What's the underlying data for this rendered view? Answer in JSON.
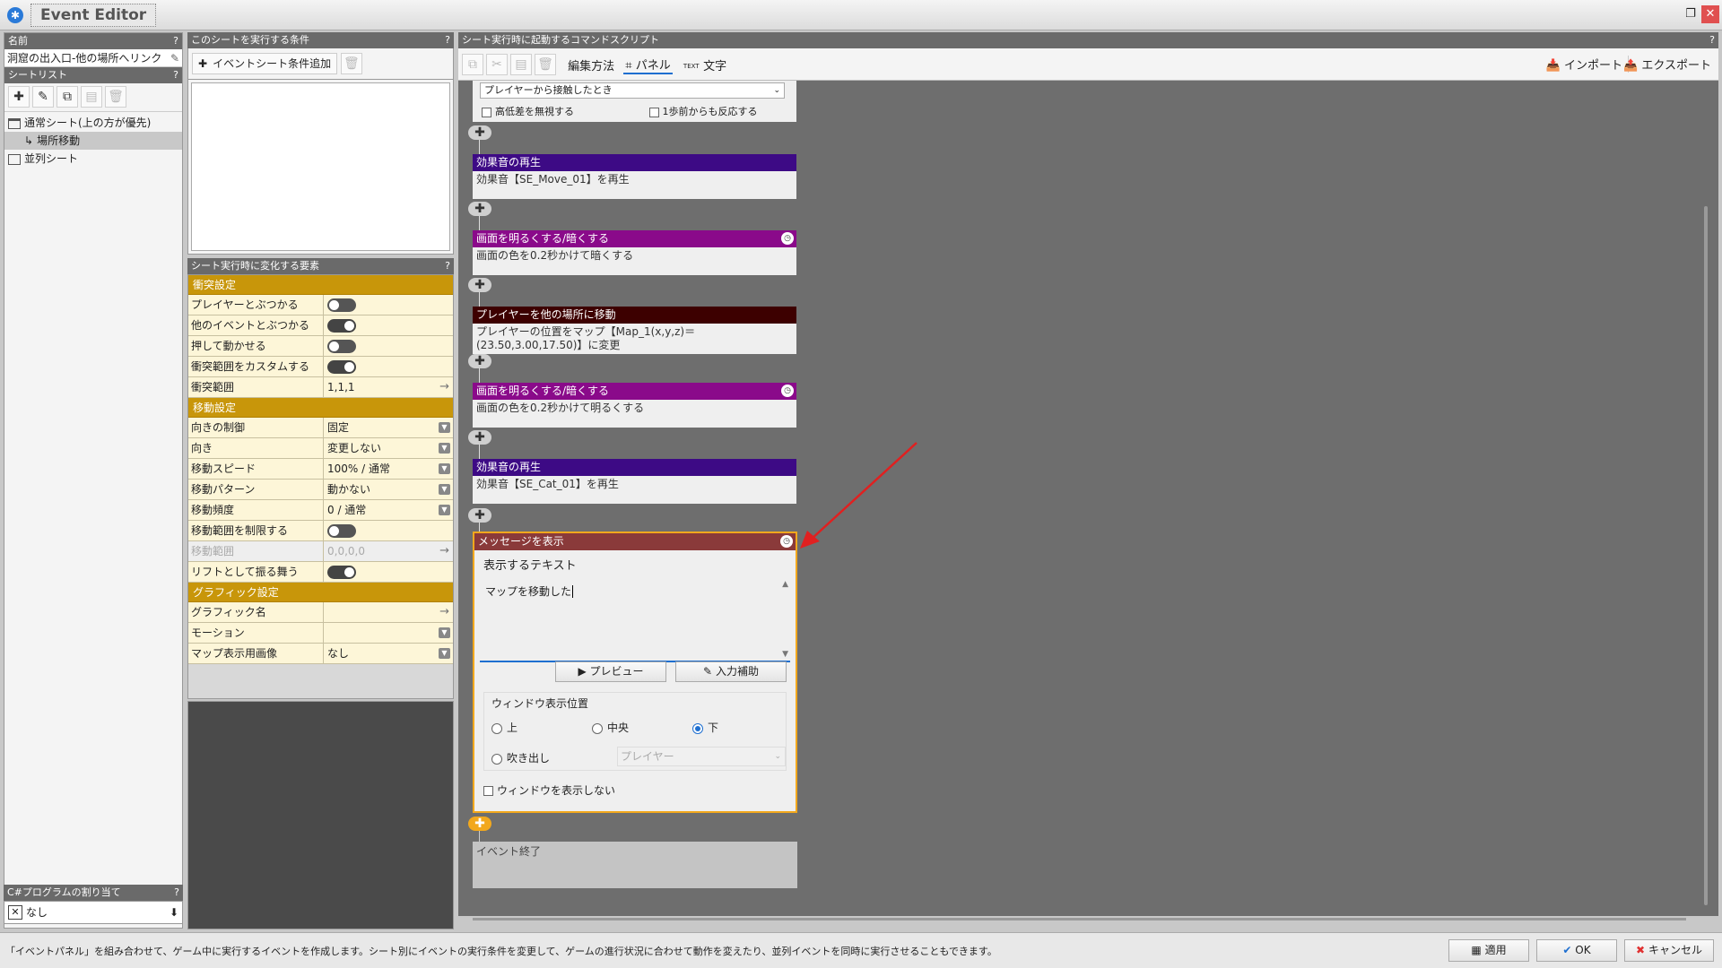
{
  "window": {
    "title": "Event Editor",
    "restore_glyph": "❐",
    "close_glyph": "✕"
  },
  "left": {
    "name_header": "名前",
    "name_header_help": "?",
    "name_value": "洞窟の出入口-他の場所へリンク",
    "sheet_list_header": "シートリスト",
    "sheet_list_help": "?",
    "tree": [
      {
        "label": "通常シート(上の方が優先)"
      },
      {
        "label": "場所移動"
      },
      {
        "label": "並列シート"
      }
    ],
    "csharp_header": "C#プログラムの割り当て",
    "csharp_help": "?",
    "csharp_value": "なし"
  },
  "conditions": {
    "header": "このシートを実行する条件",
    "help": "?",
    "add_label": "イベントシート条件追加"
  },
  "elements": {
    "header": "シート実行時に変化する要素",
    "help": "?",
    "categories": [
      {
        "title": "衝突設定",
        "rows": [
          {
            "k": "プレイヤーとぶつかる",
            "toggle": "off"
          },
          {
            "k": "他のイベントとぶつかる",
            "toggle": "on"
          },
          {
            "k": "押して動かせる",
            "toggle": "off"
          },
          {
            "k": "衝突範囲をカスタムする",
            "toggle": "on"
          },
          {
            "k": "衝突範囲",
            "v": "1,1,1",
            "arrow": true
          }
        ]
      },
      {
        "title": "移動設定",
        "rows": [
          {
            "k": "向きの制御",
            "v": "固定",
            "dd": true
          },
          {
            "k": "向き",
            "v": "変更しない",
            "dd": true
          },
          {
            "k": "移動スピード",
            "v": "100% / 通常",
            "dd": true
          },
          {
            "k": "移動パターン",
            "v": "動かない",
            "dd": true
          },
          {
            "k": "移動頻度",
            "v": "0 / 通常",
            "dd": true
          },
          {
            "k": "移動範囲を制限する",
            "toggle": "off"
          },
          {
            "k": "移動範囲",
            "v": "0,0,0,0",
            "arrow": true,
            "disabled": true
          },
          {
            "k": "リフトとして振る舞う",
            "toggle": "on"
          }
        ]
      },
      {
        "title": "グラフィック設定",
        "rows": [
          {
            "k": "グラフィック名",
            "v": "",
            "arrow": true
          },
          {
            "k": "モーション",
            "v": "",
            "dd": true
          },
          {
            "k": "マップ表示用画像",
            "v": "なし",
            "dd": true
          }
        ]
      }
    ]
  },
  "script": {
    "header": "シート実行時に起動するコマンドスクリプト",
    "help": "?",
    "toolbar": {
      "edit_method": "編集方法",
      "panel": "パネル",
      "text": "文字",
      "text_icon": "TEXT",
      "import": "インポート",
      "export": "エクスポート"
    },
    "trigger": {
      "value": "プレイヤーから接触したとき",
      "ignore_height": "高低差を無視する",
      "one_step": "1歩前からも反応する"
    },
    "commands": [
      {
        "title": "効果音の再生",
        "body": "効果音【SE_Move_01】を再生",
        "color": "#3d0a85",
        "clock": false
      },
      {
        "title": "画面を明るくする/暗くする",
        "body": "画面の色を0.2秒かけて暗くする",
        "color": "#8a0a8a",
        "clock": true
      },
      {
        "title": "プレイヤーを他の場所に移動",
        "body": "プレイヤーの位置をマップ【Map_1(x,y,z)＝(23.50,3.00,17.50)】に変更",
        "color": "#3d0000",
        "clock": false
      },
      {
        "title": "画面を明るくする/暗くする",
        "body": "画面の色を0.2秒かけて明るくする",
        "color": "#8a0a8a",
        "clock": true
      },
      {
        "title": "効果音の再生",
        "body": "効果音【SE_Cat_01】を再生",
        "color": "#3d0a85",
        "clock": false
      }
    ],
    "message": {
      "title": "メッセージを表示",
      "text_label": "表示するテキスト",
      "text_value": "マップを移動した",
      "preview": "プレビュー",
      "input_help": "入力補助",
      "position_label": "ウィンドウ表示位置",
      "positions": [
        "上",
        "中央",
        "下"
      ],
      "selected_position": "下",
      "balloon": "吹き出し",
      "balloon_target": "プレイヤー",
      "hide_window": "ウィンドウを表示しない",
      "color": "#8a3a3a",
      "accent": "#f2a81d"
    },
    "end_label": "イベント終了"
  },
  "status": {
    "text": "「イベントパネル」を組み合わせて、ゲーム中に実行するイベントを作成します。シート別にイベントの実行条件を変更して、ゲームの進行状況に合わせて動作を変えたり、並列イベントを同時に実行させることもできます。",
    "apply": "適用",
    "ok": "OK",
    "cancel": "キャンセル"
  }
}
